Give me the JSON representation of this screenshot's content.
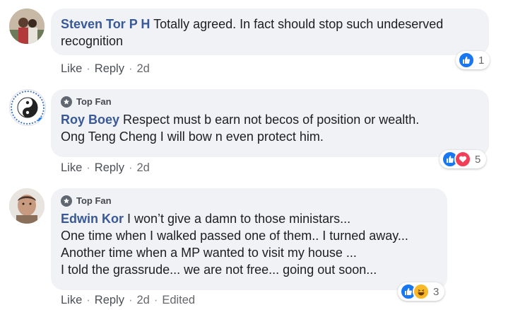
{
  "comments": [
    {
      "author": "Steven Tor P H",
      "top_fan": false,
      "lines": [
        "Totally agreed. In fact should stop such undeserved",
        "recognition"
      ],
      "actions": {
        "like": "Like",
        "reply": "Reply",
        "time": "2d"
      },
      "reactions": {
        "types": [
          "like"
        ],
        "count": "1"
      }
    },
    {
      "author": "Roy Boey",
      "top_fan": true,
      "badge": "Top Fan",
      "lines": [
        "Respect must b earn not becos of position or wealth.",
        "Ong Teng Cheng I will bow n even protect him."
      ],
      "actions": {
        "like": "Like",
        "reply": "Reply",
        "time": "2d"
      },
      "reactions": {
        "types": [
          "like",
          "love"
        ],
        "count": "5"
      }
    },
    {
      "author": "Edwin Kor",
      "top_fan": true,
      "badge": "Top Fan",
      "lines": [
        "I won’t give a damn to those ministars...",
        "One time when I walked passed one of them.. I turned away...",
        "Another time when a MP wanted to visit my house ...",
        "I told the grassrude... we are not free... going out soon..."
      ],
      "actions": {
        "like": "Like",
        "reply": "Reply",
        "time": "2d",
        "edited": "Edited"
      },
      "reactions": {
        "types": [
          "like",
          "haha"
        ],
        "count": "3"
      }
    }
  ],
  "colors": {
    "author": "#385898",
    "bubble": "#f0f2f5",
    "like": "#1877f2",
    "love": "#f33e58",
    "haha": "#f7b928"
  },
  "icons": [
    "avatar-photo",
    "top-fan-badge-icon",
    "like-reaction-icon",
    "love-reaction-icon",
    "haha-reaction-icon"
  ]
}
